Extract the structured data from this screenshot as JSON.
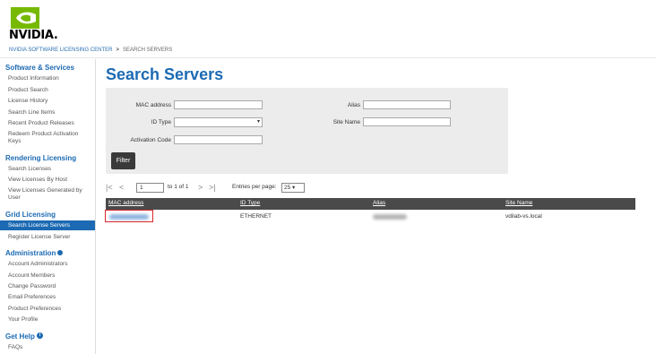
{
  "brand": {
    "logo_text": "NVIDIA.",
    "green": "#76b900",
    "accent": "#1c6ab3"
  },
  "breadcrumb": {
    "root": "NVIDIA SOFTWARE LICENSING CENTER",
    "sep": ">",
    "current": "SEARCH SERVERS"
  },
  "sidebar": {
    "software": {
      "title": "Software & Services",
      "items": [
        "Product Information",
        "Product Search",
        "License History",
        "Search Line Items",
        "Recent Product Releases",
        "Redeem Product Activation Keys"
      ]
    },
    "rendering": {
      "title": "Rendering Licensing",
      "items": [
        "Search Licenses",
        "View Licenses By Host",
        "View Licenses Generated by User"
      ]
    },
    "grid": {
      "title": "Grid Licensing",
      "items": [
        "Search License Servers",
        "Register License Server"
      ]
    },
    "admin": {
      "title": "Administration",
      "items": [
        "Account Administrators",
        "Account Members",
        "Change Password",
        "Email Preferences",
        "Product Preferences",
        "Your Profile"
      ]
    },
    "help": {
      "title": "Get Help",
      "items": [
        "FAQs"
      ]
    }
  },
  "page_title": "Search Servers",
  "filter": {
    "mac_label": "MAC address",
    "mac_value": "",
    "idtype_label": "ID Type",
    "idtype_value": "",
    "activation_label": "Activation Code",
    "activation_value": "",
    "alias_label": "Alias",
    "alias_value": "",
    "site_label": "Site Name",
    "site_value": "",
    "button": "Filter"
  },
  "pager": {
    "page": "1",
    "of_text": "to 1 of 1",
    "per_page_label": "Entries per page:",
    "per_page": "25"
  },
  "table": {
    "headers": [
      "MAC address",
      "ID Type",
      "Alias",
      "Site Name"
    ],
    "row": {
      "id_type": "ETHERNET",
      "site_name": "vdilab-vs.local"
    }
  }
}
